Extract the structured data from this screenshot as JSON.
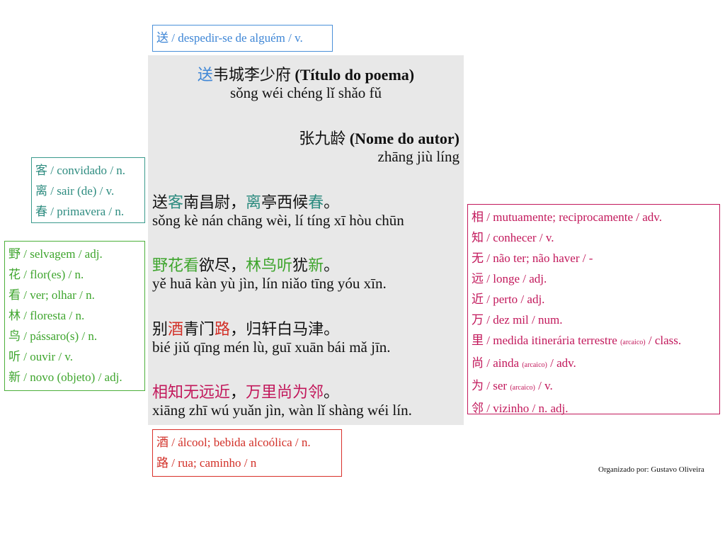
{
  "colors": {
    "blue": "#3e86d6",
    "teal": "#2e8c80",
    "green": "#3ea52d",
    "pink": "#c2185b",
    "red": "#d22f27",
    "panel_bg": "#e8e8e8"
  },
  "glossary_top": [
    {
      "hanzi": "送",
      "meaning": "despedir-se de alguém",
      "cls": "v."
    }
  ],
  "glossary_teal": [
    {
      "hanzi": "客",
      "meaning": "convidado",
      "cls": "n."
    },
    {
      "hanzi": "离",
      "meaning": "sair (de)",
      "cls": "v."
    },
    {
      "hanzi": "春",
      "meaning": "primavera",
      "cls": "n."
    }
  ],
  "glossary_green": [
    {
      "hanzi": "野",
      "meaning": "selvagem",
      "cls": "adj."
    },
    {
      "hanzi": "花",
      "meaning": "flor(es)",
      "cls": "n."
    },
    {
      "hanzi": "看",
      "meaning": "ver; olhar",
      "cls": "n."
    },
    {
      "hanzi": "林",
      "meaning": "floresta",
      "cls": "n."
    },
    {
      "hanzi": "鸟",
      "meaning": "pássaro(s)",
      "cls": "n."
    },
    {
      "hanzi": "听",
      "meaning": "ouvir",
      "cls": "v."
    },
    {
      "hanzi": "新",
      "meaning": "novo (objeto)",
      "cls": "adj."
    }
  ],
  "glossary_pink": [
    {
      "hanzi": "相",
      "meaning": "mutuamente; reciprocamente",
      "note": "",
      "cls": "adv."
    },
    {
      "hanzi": "知",
      "meaning": "conhecer",
      "note": "",
      "cls": "v."
    },
    {
      "hanzi": "无",
      "meaning": "não ter; não haver",
      "note": "",
      "cls": "-"
    },
    {
      "hanzi": "远",
      "meaning": "longe",
      "note": "",
      "cls": "adj."
    },
    {
      "hanzi": "近",
      "meaning": "perto",
      "note": "",
      "cls": "adj."
    },
    {
      "hanzi": "万",
      "meaning": "dez mil",
      "note": "",
      "cls": "num."
    },
    {
      "hanzi": "里",
      "meaning": "medida itinerária terrestre",
      "note": "(arcaico)",
      "cls": "class."
    },
    {
      "hanzi": "尚",
      "meaning": "ainda",
      "note": "(arcaico)",
      "cls": "adv."
    },
    {
      "hanzi": "为",
      "meaning": "ser",
      "note": "(arcaico)",
      "cls": "v."
    },
    {
      "hanzi": "邻",
      "meaning": "vizinho",
      "note": "",
      "cls": "n. adj."
    }
  ],
  "glossary_red": [
    {
      "hanzi": "酒",
      "meaning": "álcool; bebida alcoólica",
      "cls": "n."
    },
    {
      "hanzi": "路",
      "meaning": "rua; caminho",
      "cls": "n"
    }
  ],
  "poem": {
    "title_first_char": "送",
    "title_rest": "韦城李少府",
    "title_label": "(Título do poema)",
    "title_pinyin": "sǒng wéi chéng lǐ shǎo fǔ",
    "author": "张九龄",
    "author_label": "(Nome do autor)",
    "author_pinyin": "zhāng jiù líng",
    "verses": [
      {
        "segments": [
          {
            "text": "送",
            "color": "dark"
          },
          {
            "text": "客",
            "color": "teal"
          },
          {
            "text": "南昌尉，",
            "color": "dark"
          },
          {
            "text": "离",
            "color": "teal"
          },
          {
            "text": "亭西候",
            "color": "dark"
          },
          {
            "text": "春",
            "color": "teal"
          },
          {
            "text": "。",
            "color": "dark"
          }
        ],
        "pinyin": "sǒng kè nán chāng wèi, lí tíng xī hòu chūn"
      },
      {
        "segments": [
          {
            "text": "野花看",
            "color": "green"
          },
          {
            "text": "欲尽，",
            "color": "dark"
          },
          {
            "text": "林鸟听",
            "color": "green"
          },
          {
            "text": "犹",
            "color": "dark"
          },
          {
            "text": "新",
            "color": "green"
          },
          {
            "text": "。",
            "color": "dark"
          }
        ],
        "pinyin": "yě huā kàn yù jìn, lín niǎo tīng yóu xīn."
      },
      {
        "segments": [
          {
            "text": "别",
            "color": "dark"
          },
          {
            "text": "酒",
            "color": "red"
          },
          {
            "text": "青门",
            "color": "dark"
          },
          {
            "text": "路",
            "color": "red"
          },
          {
            "text": "，归轩白马津。",
            "color": "dark"
          }
        ],
        "pinyin": "bié jiǔ qīng mén lù, guī xuān bái mǎ jīn."
      },
      {
        "segments": [
          {
            "text": "相知无远近",
            "color": "pink"
          },
          {
            "text": "，",
            "color": "dark"
          },
          {
            "text": "万里尚为邻",
            "color": "pink"
          },
          {
            "text": "。",
            "color": "dark"
          }
        ],
        "pinyin": "xiāng zhī wú yuǎn jìn, wàn lǐ shàng wéi lín."
      }
    ]
  },
  "credit": "Organizado por: Gustavo Oliveira"
}
